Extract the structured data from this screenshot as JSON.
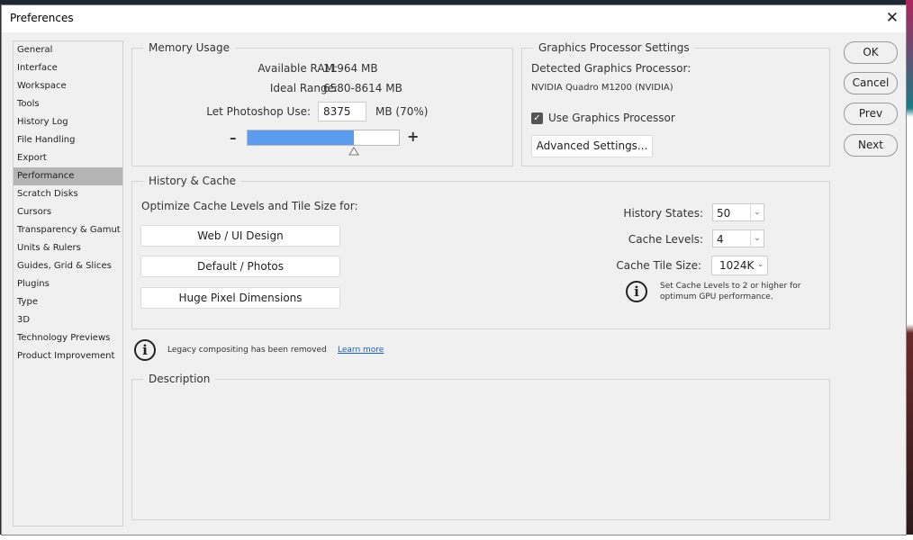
{
  "window": {
    "title": "Preferences"
  },
  "sidebar": {
    "items": [
      {
        "label": "General"
      },
      {
        "label": "Interface"
      },
      {
        "label": "Workspace"
      },
      {
        "label": "Tools"
      },
      {
        "label": "History Log"
      },
      {
        "label": "File Handling"
      },
      {
        "label": "Export"
      },
      {
        "label": "Performance",
        "selected": true
      },
      {
        "label": "Scratch Disks"
      },
      {
        "label": "Cursors"
      },
      {
        "label": "Transparency & Gamut"
      },
      {
        "label": "Units & Rulers"
      },
      {
        "label": "Guides, Grid & Slices"
      },
      {
        "label": "Plugins"
      },
      {
        "label": "Type"
      },
      {
        "label": "3D"
      },
      {
        "label": "Technology Previews"
      },
      {
        "label": "Product Improvement"
      }
    ]
  },
  "memory": {
    "title": "Memory Usage",
    "available_label": "Available RAM:",
    "available_value": "11964 MB",
    "ideal_label": "Ideal Range:",
    "ideal_value": "6580-8614 MB",
    "use_label": "Let Photoshop Use:",
    "use_value": "8375",
    "use_unit": "MB (70%)",
    "minus": "–",
    "plus": "+",
    "slider_percent": 70,
    "fill_color": "#5b9bf0"
  },
  "gpu": {
    "title": "Graphics Processor Settings",
    "detected_label": "Detected Graphics Processor:",
    "detected_value": "NVIDIA Quadro M1200 (NVIDIA)",
    "use_gpu_label": "Use Graphics Processor",
    "use_gpu_checked": true,
    "advanced_label": "Advanced Settings..."
  },
  "history": {
    "title": "History & Cache",
    "optimize_label": "Optimize Cache Levels and Tile Size for:",
    "buttons": [
      "Web / UI Design",
      "Default / Photos",
      "Huge Pixel Dimensions"
    ],
    "states_label": "History States:",
    "states_value": "50",
    "levels_label": "Cache Levels:",
    "levels_value": "4",
    "tile_label": "Cache Tile Size:",
    "tile_value": "1024K",
    "hint": "Set Cache Levels to 2 or higher for",
    "hint2": "optimum GPU performance."
  },
  "notice": {
    "text": "Legacy compositing has been removed",
    "link": "Learn more"
  },
  "description": {
    "title": "Description"
  },
  "actions": {
    "ok": "OK",
    "cancel": "Cancel",
    "prev": "Prev",
    "next": "Next"
  }
}
